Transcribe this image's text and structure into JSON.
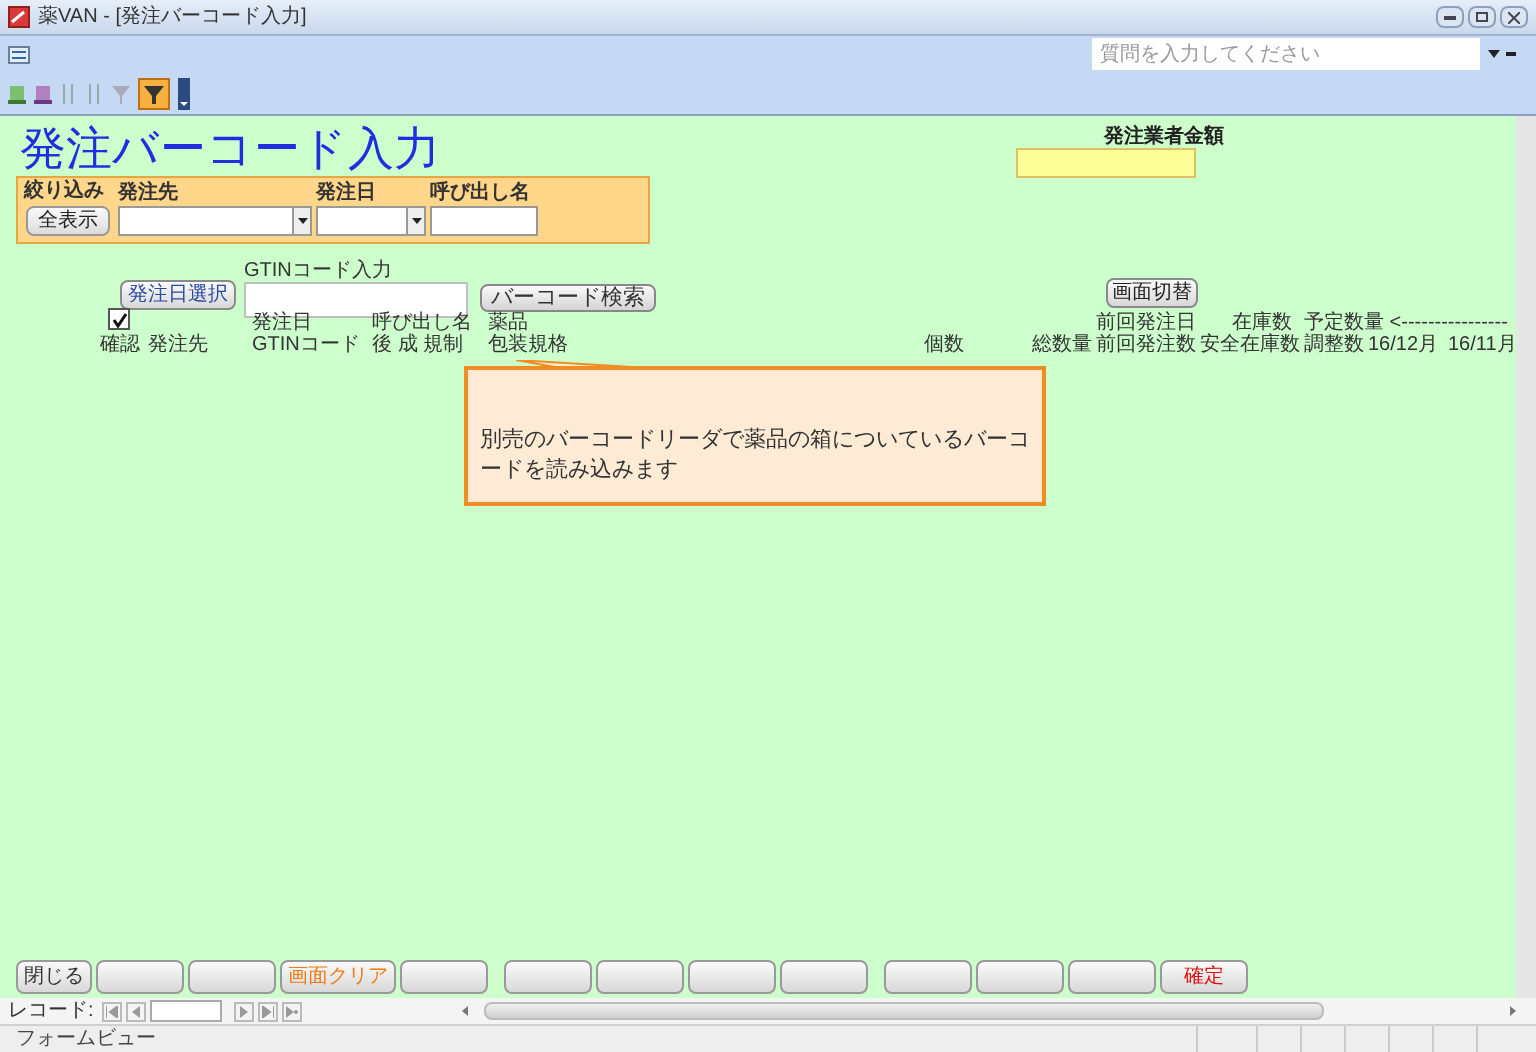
{
  "window": {
    "title": "薬VAN - [発注バーコード入力]"
  },
  "help_search": {
    "placeholder": "質問を入力してください"
  },
  "form": {
    "title": "発注バーコード入力",
    "total": {
      "label": "発注業者金額"
    },
    "filter": {
      "label": "絞り込み",
      "show_all_button": "全表示",
      "fields": [
        {
          "label": "発注先",
          "kind": "dropdown"
        },
        {
          "label": "発注日",
          "kind": "dropdown"
        },
        {
          "label": "呼び出し名",
          "kind": "text"
        }
      ]
    },
    "date_button": "発注日選択",
    "gtin": {
      "label": "GTINコード入力",
      "button": "バーコード検索"
    },
    "switch_button": "画面切替",
    "select_all": {
      "checked": true
    },
    "header_row_1": [
      "発注日",
      "呼び出し名",
      "薬品",
      "前回発注日",
      "在庫数",
      "予定数量 <----------------"
    ],
    "header_row_2": [
      "確認",
      "発注先",
      "GTINコード",
      "後 成 規制",
      "包装規格",
      "個数",
      "総数量",
      "前回発注数",
      "安全在庫数",
      "調整数",
      "16/12月",
      "16/11月"
    ]
  },
  "callout": {
    "text": "別売のバーコードリーダで薬品の箱についているバーコードを読み込みます"
  },
  "bottom_buttons": [
    {
      "kind": "label",
      "label": "閉じる",
      "color": "#333333"
    },
    {
      "kind": "blank"
    },
    {
      "kind": "blank"
    },
    {
      "kind": "label",
      "label": "画面クリア",
      "color": "#f07a10"
    },
    {
      "kind": "blank"
    },
    {
      "kind": "gap"
    },
    {
      "kind": "blank"
    },
    {
      "kind": "blank"
    },
    {
      "kind": "blank"
    },
    {
      "kind": "blank"
    },
    {
      "kind": "gap"
    },
    {
      "kind": "blank"
    },
    {
      "kind": "blank"
    },
    {
      "kind": "blank"
    },
    {
      "kind": "label",
      "label": "確定",
      "color": "#e01010"
    }
  ],
  "record_nav": {
    "label": "レコード:"
  },
  "status_bar": {
    "text": "フォームビュー"
  }
}
